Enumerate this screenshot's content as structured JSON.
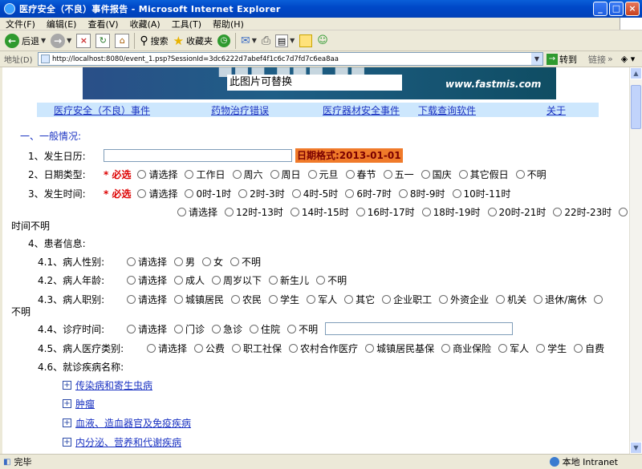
{
  "window": {
    "title": "医疗安全（不良）事件报告 - Microsoft Internet Explorer"
  },
  "menu": [
    "文件(F)",
    "编辑(E)",
    "查看(V)",
    "收藏(A)",
    "工具(T)",
    "帮助(H)"
  ],
  "toolbar": {
    "back": "后退",
    "search": "搜索",
    "favorites": "收藏夹"
  },
  "address": {
    "label": "地址(D)",
    "url": "http://localhost:8080/event_1.psp?SessionId=3dc6222d7abef4f1c6c7d7fd7c6ea8aa",
    "go": "转到",
    "links": "链接"
  },
  "banner": {
    "placeholder": "此图片可替换",
    "site": "www.fastmis.com"
  },
  "nav": [
    "医疗安全（不良）事件",
    "药物治疗错误",
    "医疗器材安全事件",
    "下载查询软件",
    "关于"
  ],
  "form": {
    "section1": "一、一般情况:",
    "date_label": "1、发生日历:",
    "date_format": "日期格式:2013-01-01",
    "required": "* 必选",
    "datetype_label": "2、日期类型:",
    "datetype_options": [
      "请选择",
      "工作日",
      "周六",
      "周日",
      "元旦",
      "春节",
      "五一",
      "国庆",
      "其它假日",
      "不明"
    ],
    "time_label": "3、发生时间:",
    "time_options_1": [
      "请选择",
      "0时-1时",
      "2时-3时",
      "4时-5时",
      "6时-7时",
      "8时-9时",
      "10时-11时"
    ],
    "time_options_2": [
      "请选择",
      "12时-13时",
      "14时-15时",
      "16时-17时",
      "18时-19时",
      "20时-21时",
      "22时-23时"
    ],
    "time_unknown": "时间不明",
    "patient_label": "4、患者信息:",
    "sex_label": "4.1、病人性别:",
    "sex_options": [
      "请选择",
      "男",
      "女",
      "不明"
    ],
    "age_label": "4.2、病人年龄:",
    "age_options": [
      "请选择",
      "成人",
      "周岁以下",
      "新生儿",
      "不明"
    ],
    "job_label": "4.3、病人职别:",
    "job_options": [
      "请选择",
      "城镇居民",
      "农民",
      "学生",
      "军人",
      "其它",
      "企业职工",
      "外资企业",
      "机关",
      "退休/离休"
    ],
    "job_unknown": "不明",
    "visit_label": "4.4、诊疗时间:",
    "visit_options": [
      "请选择",
      "门诊",
      "急诊",
      "住院",
      "不明"
    ],
    "insurance_label": "4.5、病人医疗类别:",
    "insurance_options": [
      "请选择",
      "公费",
      "职工社保",
      "农村合作医疗",
      "城镇居民基保",
      "商业保险",
      "军人",
      "学生",
      "自费"
    ],
    "disease_label": "4.6、就诊疾病名称:",
    "disease_items": [
      "传染病和寄生虫病",
      "肿瘤",
      "血液、造血器官及免疫疾病",
      "内分泌、营养和代谢疾病"
    ]
  },
  "status": {
    "text": "完毕",
    "zone": "本地 Intranet"
  }
}
